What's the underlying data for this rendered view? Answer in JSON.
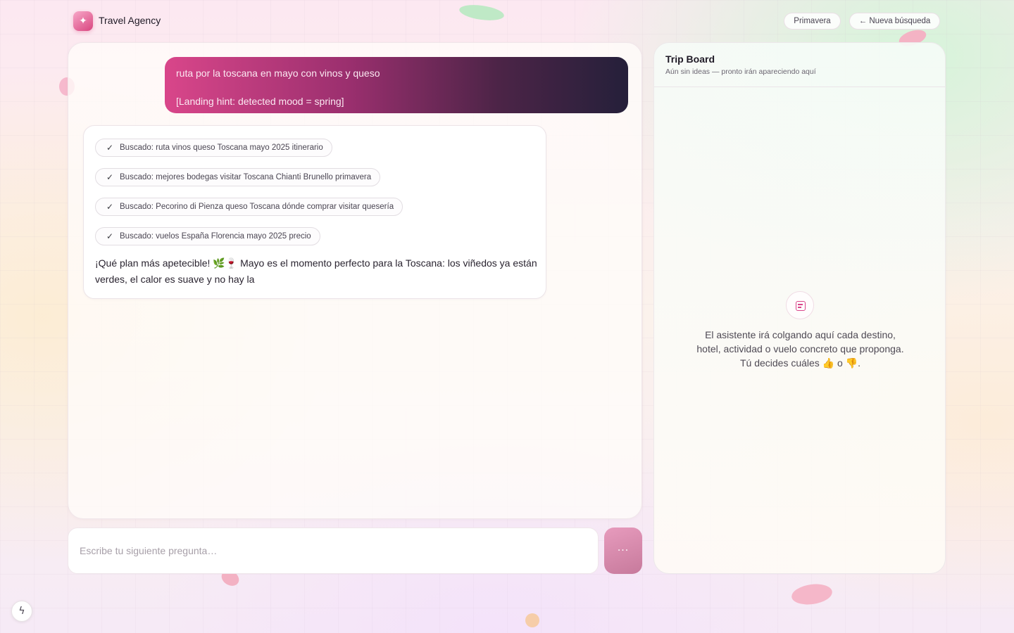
{
  "header": {
    "brand": "Travel Agency",
    "logo_icon": "sparkle-icon",
    "season_button": "Primavera",
    "new_search_button": "← Nueva búsqueda"
  },
  "chat": {
    "user_message": {
      "line1": "ruta por la toscana en mayo con vinos y queso",
      "line2": "[Landing hint: detected mood = spring]"
    },
    "assistant": {
      "searches": [
        "Buscado: ruta vinos queso Toscana mayo 2025 itinerario",
        "Buscado: mejores bodegas visitar Toscana Chianti Brunello primavera",
        "Buscado: Pecorino di Pienza queso Toscana dónde comprar visitar quesería",
        "Buscado: vuelos España Florencia mayo 2025 precio"
      ],
      "text": "¡Qué plan más apetecible! 🌿🍷 Mayo es el momento perfecto para la Toscana: los viñedos ya están verdes, el calor es suave y no hay la"
    }
  },
  "composer": {
    "placeholder": "Escribe tu siguiente pregunta…",
    "send_label": "···"
  },
  "board": {
    "title": "Trip Board",
    "subtitle": "Aún sin ideas — pronto irán apareciendo aquí",
    "empty_text": "El asistente irá colgando aquí cada destino, hotel, actividad o vuelo concreto que proponga. Tú decides cuáles 👍 o 👎."
  },
  "colors": {
    "accent": "#d9468a",
    "user_bubble_start": "#d9468a",
    "user_bubble_end": "#25203a"
  }
}
